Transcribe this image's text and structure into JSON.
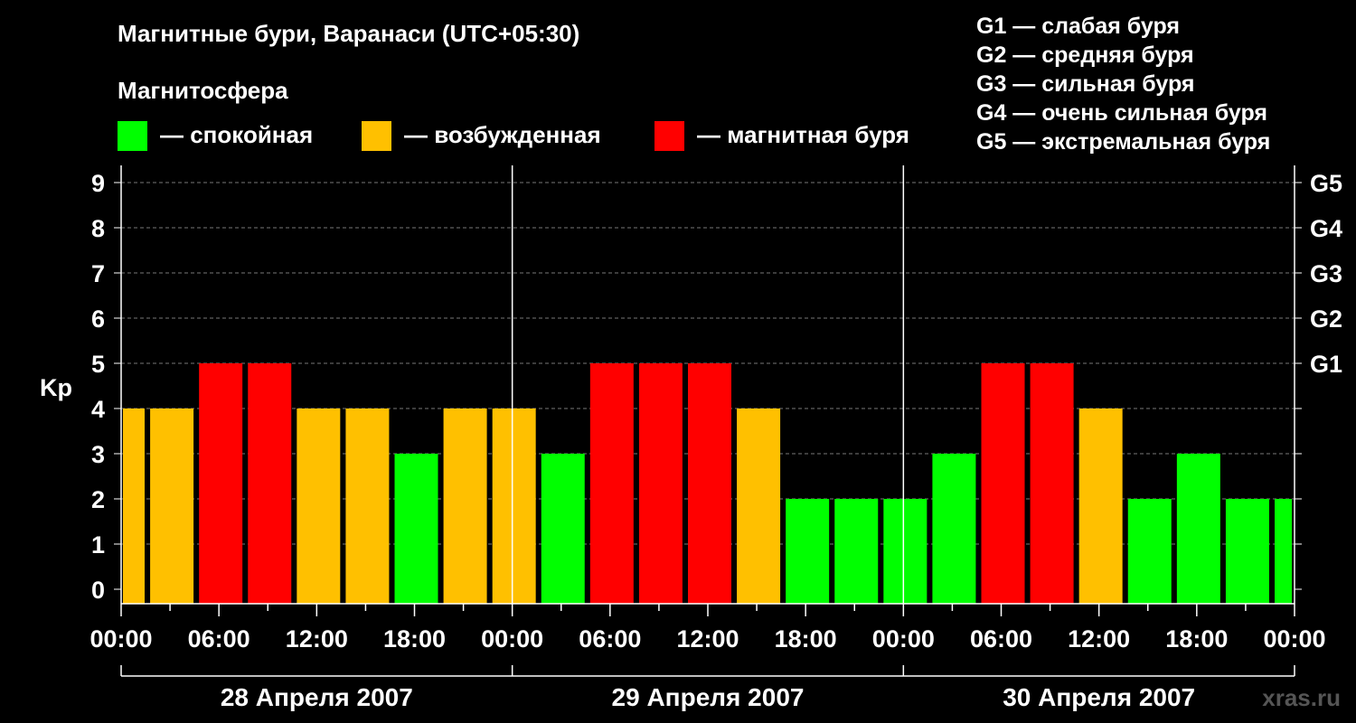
{
  "header": {
    "title": "Магнитные бури, Варанаси (UTC+05:30)",
    "magnetosphere_label": "Магнитосфера"
  },
  "legend": [
    {
      "label": "— спокойная",
      "color": "#00ff00"
    },
    {
      "label": "— возбужденная",
      "color": "#ffc000"
    },
    {
      "label": "— магнитная буря",
      "color": "#ff0000"
    }
  ],
  "g_scale": [
    "G1 — слабая буря",
    "G2 — средняя буря",
    "G3 — сильная буря",
    "G4 — очень сильная буря",
    "G5 — экстремальная буря"
  ],
  "watermark": "xras.ru",
  "chart_data": {
    "type": "bar",
    "ylabel": "Kp",
    "ylim": [
      0,
      9
    ],
    "y_ticks": [
      "0",
      "1",
      "2",
      "3",
      "4",
      "5",
      "6",
      "7",
      "8",
      "9"
    ],
    "right_ticks": [
      {
        "value": 5,
        "label": "G1"
      },
      {
        "value": 6,
        "label": "G2"
      },
      {
        "value": 7,
        "label": "G3"
      },
      {
        "value": 8,
        "label": "G4"
      },
      {
        "value": 9,
        "label": "G5"
      }
    ],
    "x_tick_labels": [
      "00:00",
      "06:00",
      "12:00",
      "18:00",
      "00:00",
      "06:00",
      "12:00",
      "18:00",
      "00:00",
      "06:00",
      "12:00",
      "18:00",
      "00:00"
    ],
    "days": [
      "28 Апреля 2007",
      "29 Апреля 2007",
      "30 Апреля 2007"
    ],
    "grid": true,
    "colors": {
      "quiet": "#00ff00",
      "active": "#ffc000",
      "storm": "#ff0000"
    },
    "series": [
      {
        "values": [
          4,
          4,
          5,
          5,
          4,
          4,
          3,
          4,
          4,
          3,
          5,
          5,
          5,
          4,
          2,
          2,
          2,
          3,
          5,
          5,
          4,
          2,
          3,
          2,
          2
        ]
      }
    ]
  }
}
